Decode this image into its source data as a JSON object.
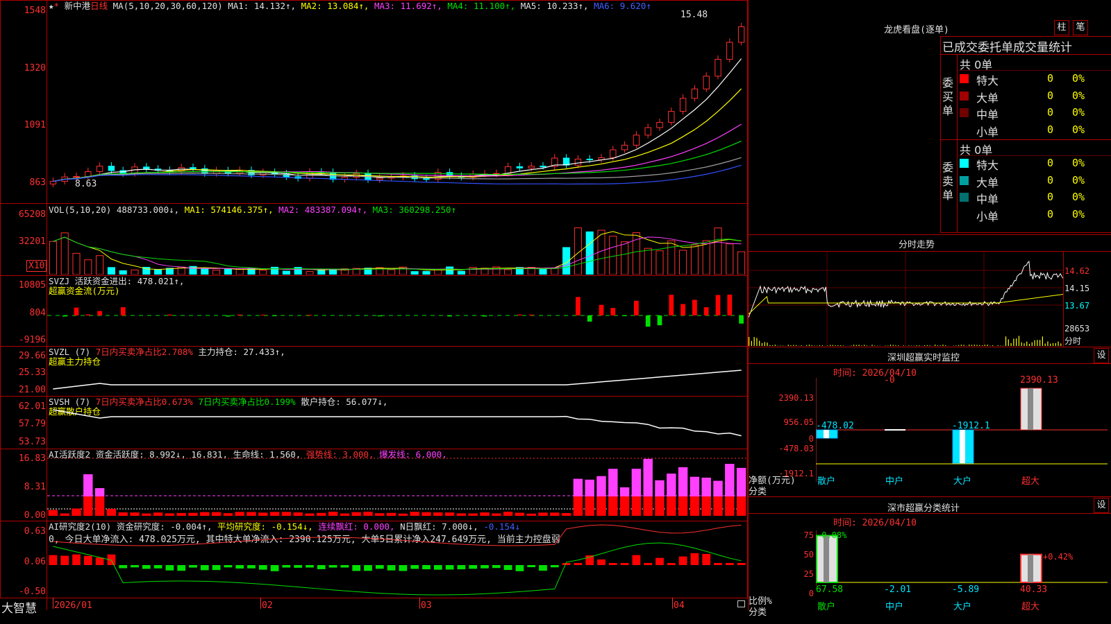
{
  "window": {
    "app_name": "大智慧"
  },
  "kline": {
    "title_star": "★",
    "stock_name": "新中港",
    "period": "日线",
    "ma_def": "MA(5,10,20,30,60,120)",
    "ma1": "MA1: 14.132↑,",
    "ma2": "MA2: 13.084↑,",
    "ma3": "MA3: 11.692↑,",
    "ma4": "MA4: 11.100↑,",
    "ma5": "MA5: 10.233↑,",
    "ma6": "MA6: 9.620↑",
    "axis": [
      "1548",
      "1320",
      "1091",
      "863"
    ],
    "high_label": "15.48",
    "low_label": "8.63"
  },
  "vol": {
    "header": "VOL(5,10,20)",
    "value": "488733.000↓,",
    "ma1": "MA1: 574146.375↑,",
    "ma2": "MA2: 483387.094↑,",
    "ma3": "MA3: 360298.250↑",
    "axis": [
      "65208",
      "32201"
    ],
    "unit": "X10"
  },
  "svzj": {
    "line1_name": "SVZJ",
    "line1_text": "活跃资金进出: 478.021↑,",
    "line2": "超赢资金流(万元)",
    "axis": [
      "10805",
      "804",
      "-9196"
    ]
  },
  "svzl": {
    "name": "SVZL (7)",
    "ratio": "7日内买卖净占比2.708%",
    "hold": "主力持仓: 27.433↑,",
    "line2": "超赢主力持仓",
    "axis": [
      "29.66",
      "25.33",
      "21.00"
    ]
  },
  "svsh": {
    "name": "SVSH (7)",
    "ratio1": "7日内买卖净占比0.673%",
    "ratio2": "7日内买卖净占比0.199%",
    "hold": "散户持仓: 56.077↓,",
    "line2": "超赢散户持仓",
    "axis": [
      "62.01",
      "57.79",
      "53.73"
    ]
  },
  "ai_active": {
    "name": "AI活跃度2",
    "a": "资金活跃度: 8.992↓,",
    "b": "16.831,",
    "c": "生命线: 1.560,",
    "d": "强势线: 3.000,",
    "e": "爆发线: 6.000,",
    "axis": [
      "16.83",
      "8.31",
      "0.00"
    ]
  },
  "ai_research": {
    "name": "AI研究度2(10)",
    "a": "资金研究度: -0.004↑,",
    "b": "平均研究度: -0.154↓,",
    "c": "连续飘红: 0.000,",
    "d": "N日飘红: 7.000↓,",
    "e": "-0.154↓",
    "line2": "0, 今日大单净流入: 478.025万元, 其中特大单净流入: 2390.125万元, 大单5日累计净入247.649万元, 当前主力控盘弱",
    "axis": [
      "0.63",
      "0.06",
      "-0.50"
    ]
  },
  "xaxis": [
    "2026/01",
    "02",
    "03",
    "04"
  ],
  "dragon": {
    "title": "龙虎看盘(逐单)",
    "btn1": "柱",
    "btn2": "笔",
    "tabs": "已成交委托单成交量统计",
    "buy_label": "委买单",
    "sell_label": "委卖单",
    "buy_total": "共 0单",
    "sell_total": "共 0单",
    "buy_rows": [
      {
        "name": "特大",
        "count": "0",
        "pct": "0%",
        "color": "#ff0000"
      },
      {
        "name": "大单",
        "count": "0",
        "pct": "0%",
        "color": "#a00000"
      },
      {
        "name": "中单",
        "count": "0",
        "pct": "0%",
        "color": "#700000"
      },
      {
        "name": "小单",
        "count": "0",
        "pct": "0%",
        "color": "#000000"
      }
    ],
    "sell_rows": [
      {
        "name": "特大",
        "count": "0",
        "pct": "0%",
        "color": "#00ffff"
      },
      {
        "name": "大单",
        "count": "0",
        "pct": "0%",
        "color": "#00a0a0"
      },
      {
        "name": "中单",
        "count": "0",
        "pct": "0%",
        "color": "#007070"
      },
      {
        "name": "小单",
        "count": "0",
        "pct": "0%",
        "color": "#000000"
      }
    ]
  },
  "intraday": {
    "title": "分时走势",
    "axis": [
      "14.62",
      "14.15",
      "13.67"
    ],
    "vol_axis": "28653",
    "vol_unit": "分时"
  },
  "monitor": {
    "title": "深圳超赢实时监控",
    "btn": "设",
    "time": "时间: 2026/04/10",
    "axis": [
      "2390.13",
      "956.05",
      "0",
      "-478.03",
      "-1912.1"
    ],
    "ylabel": "净额(万元)",
    "xlabel": "分类",
    "bars": [
      {
        "cat": "散户",
        "value": "-478.02",
        "v": -478.02
      },
      {
        "cat": "中户",
        "value": "-0",
        "v": 0
      },
      {
        "cat": "大户",
        "value": "-1912.1",
        "v": -1912.1
      },
      {
        "cat": "超大",
        "value": "2390.13",
        "v": 2390.13
      }
    ]
  },
  "classify": {
    "title": "深市超赢分类统计",
    "btn": "设",
    "time": "时间: 2026/04/10",
    "axis": [
      "75",
      "50",
      "25",
      "0"
    ],
    "ylabel": "比例%",
    "xlabel": "分类",
    "top_labels": [
      "-0.08%",
      "+0.42%"
    ],
    "bars": [
      {
        "cat": "散户",
        "value": "67.58",
        "v": 67.58
      },
      {
        "cat": "中户",
        "value": "-2.01",
        "v": -2.01
      },
      {
        "cat": "大户",
        "value": "-5.89",
        "v": -5.89
      },
      {
        "cat": "超大",
        "value": "40.33",
        "v": 40.33
      }
    ]
  }
}
